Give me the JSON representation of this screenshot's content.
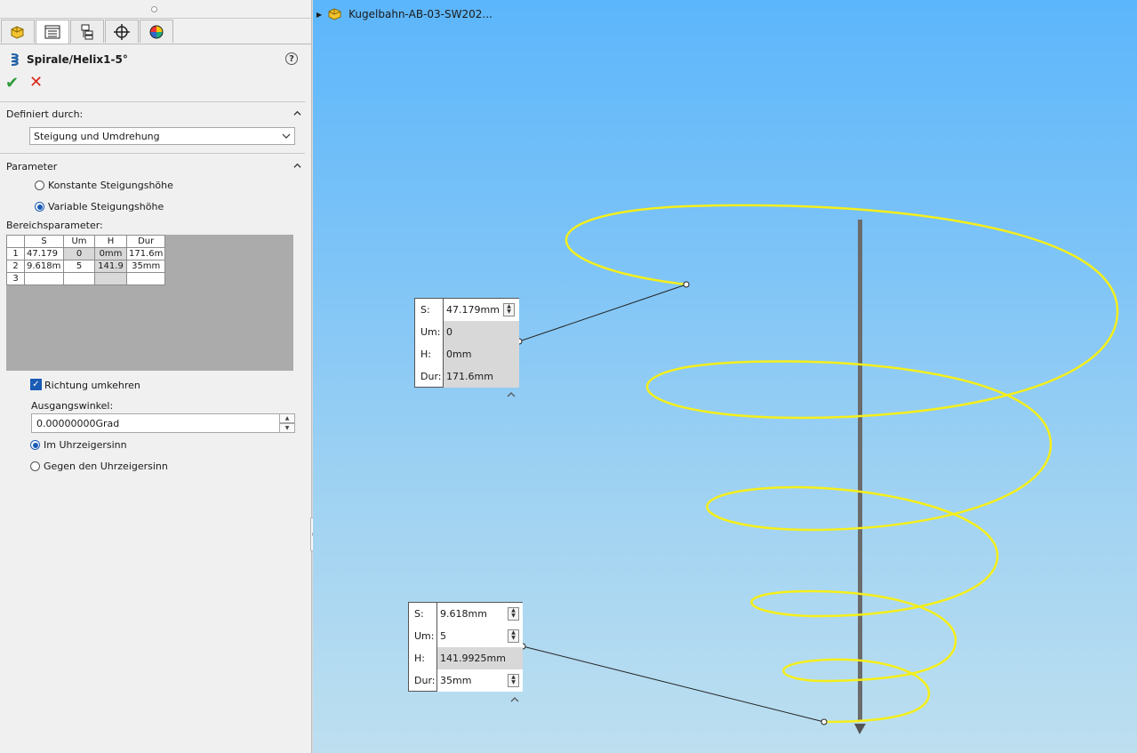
{
  "feature": {
    "title": "Spirale/Helix1-5°",
    "ok_icon": "check-icon",
    "cancel_icon": "close-icon",
    "help_icon": "?"
  },
  "tabs": [
    "feature-manager-icon",
    "property-manager-icon",
    "configuration-manager-icon",
    "dimxpert-icon",
    "display-manager-icon"
  ],
  "defined_by": {
    "label": "Definiert durch:",
    "value": "Steigung und Umdrehung"
  },
  "parameter": {
    "label": "Parameter",
    "option_constant": "Konstante Steigungshöhe",
    "option_variable": "Variable Steigungshöhe",
    "selected": "variable",
    "range_label": "Bereichsparameter:",
    "columns": [
      "S",
      "Um",
      "H",
      "Dur"
    ],
    "rows": [
      {
        "n": "1",
        "s": "47.179",
        "um": "0",
        "h": "0mm",
        "dur": "171.6m"
      },
      {
        "n": "2",
        "s": "9.618m",
        "um": "5",
        "h": "141.9",
        "dur": "35mm"
      },
      {
        "n": "3",
        "s": "",
        "um": "",
        "h": "",
        "dur": ""
      }
    ],
    "reverse_label": "Richtung umkehren",
    "reverse_checked": true,
    "start_angle_label": "Ausgangswinkel:",
    "start_angle_value": "0.00000000Grad",
    "cw_label": "Im Uhrzeigersinn",
    "ccw_label": "Gegen den Uhrzeigersinn",
    "direction": "cw"
  },
  "viewport": {
    "tree_label": "Kugelbahn-AB-03-SW202...",
    "callout1": {
      "s_key": "S:",
      "s_val": "47.179mm",
      "um_key": "Um:",
      "um_val": "0",
      "h_key": "H:",
      "h_val": "0mm",
      "dur_key": "Dur:",
      "dur_val": "171.6mm"
    },
    "callout2": {
      "s_key": "S:",
      "s_val": "9.618mm",
      "um_key": "Um:",
      "um_val": "5",
      "h_key": "H:",
      "h_val": "141.9925mm",
      "dur_key": "Dur:",
      "dur_val": "35mm"
    },
    "helix_color": "#f5ef1a",
    "bg_top": "#5cb6fb",
    "bg_bottom": "#bddff0"
  }
}
